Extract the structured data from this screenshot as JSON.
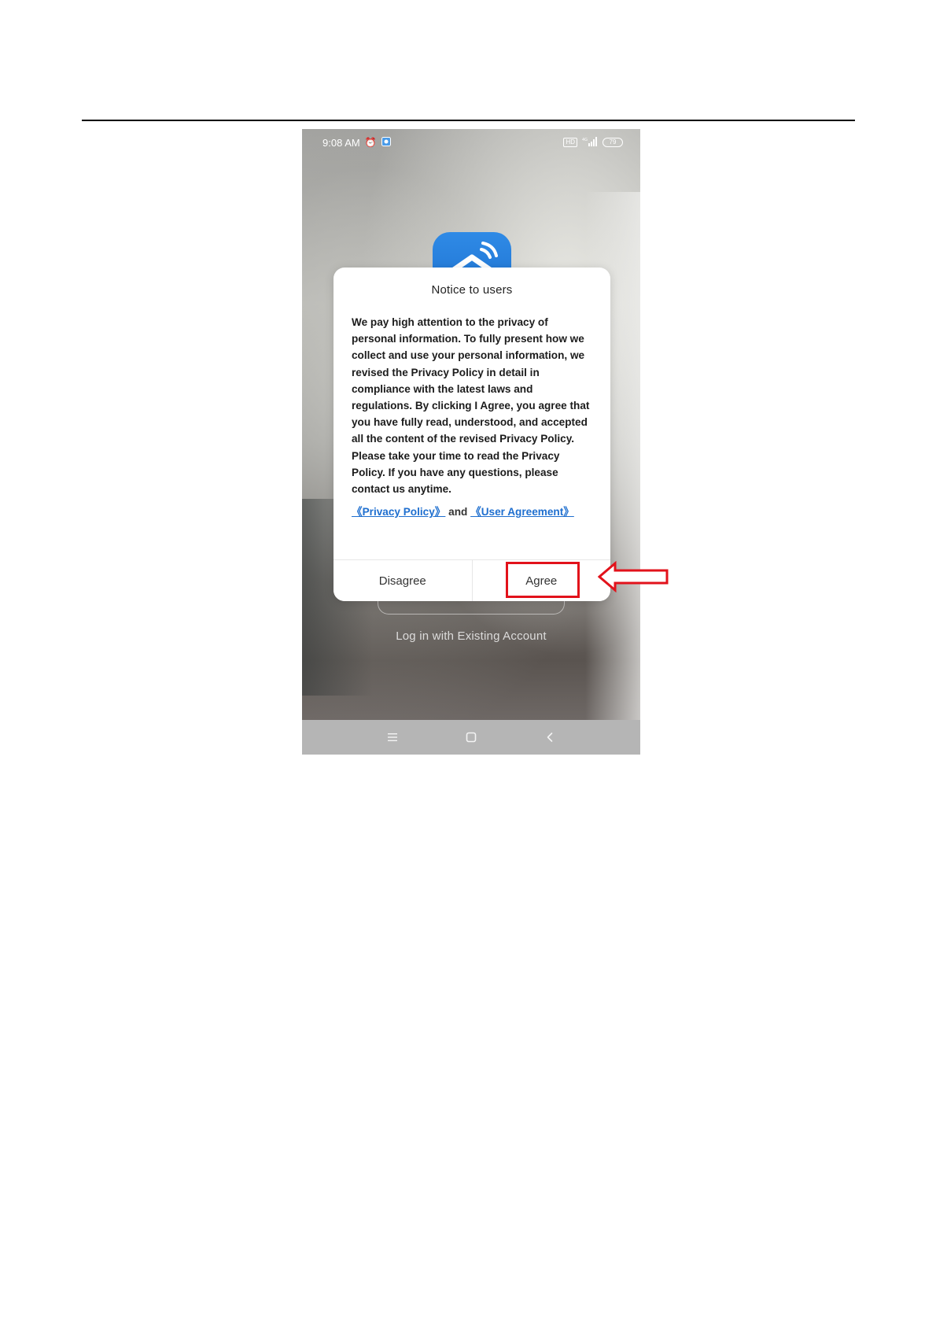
{
  "status_bar": {
    "time": "9:08 AM",
    "alarm_icon": "alarm-clock-icon",
    "app_badge_icon": "app-notification-icon",
    "hd_label": "HD",
    "network_label": "4G",
    "battery_level": "79"
  },
  "app_icon": {
    "icon": "smart-home-icon",
    "color": "#2a82e0"
  },
  "dialog": {
    "title": "Notice to users",
    "body": "We pay high attention to the privacy of personal information. To fully present how we collect and use your personal information, we revised the Privacy Policy in detail in compliance with the latest laws and regulations. By clicking I Agree, you agree that you have fully read, understood, and accepted all the content of the revised Privacy Policy. Please take your time to read the Privacy Policy. If you have any questions, please contact us anytime.",
    "privacy_link": "《Privacy Policy》",
    "link_separator": " and ",
    "user_agreement_link": "《User Agreement》",
    "disagree_label": "Disagree",
    "agree_label": "Agree"
  },
  "background": {
    "login_existing_label": "Log in with Existing Account"
  },
  "nav_bar": {
    "menu_icon": "menu-icon",
    "home_icon": "home-square-icon",
    "back_icon": "back-chevron-icon"
  },
  "annotation": {
    "highlight_color": "#e2121b"
  }
}
